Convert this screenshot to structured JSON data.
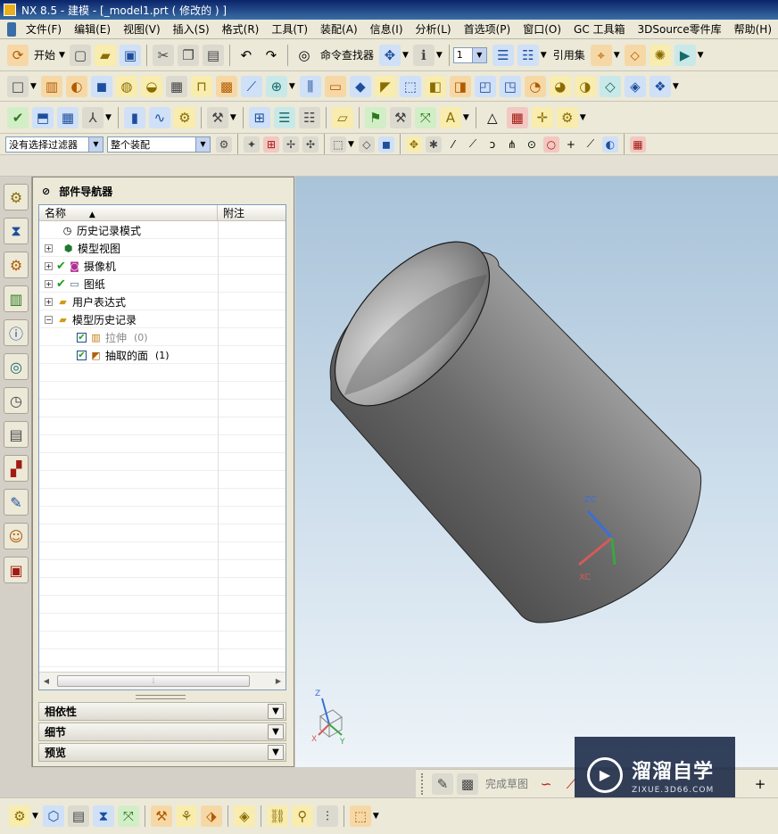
{
  "window": {
    "title": "NX 8.5 - 建模 - [_model1.prt  ( 修改的 ) ]"
  },
  "menubar": {
    "items": [
      "文件(F)",
      "编辑(E)",
      "视图(V)",
      "插入(S)",
      "格式(R)",
      "工具(T)",
      "装配(A)",
      "信息(I)",
      "分析(L)",
      "首选项(P)",
      "窗口(O)",
      "GC 工具箱",
      "3DSource零件库",
      "帮助(H)"
    ]
  },
  "toolbar": {
    "start_label": "开始",
    "command_finder_label": "命令查找器",
    "layer_value": "1",
    "reference_set_label": "引用集"
  },
  "selection_bar": {
    "filter_value": "没有选择过滤器",
    "scope_value": "整个装配"
  },
  "navigator": {
    "title": "部件导航器",
    "col_name": "名称",
    "col_note": "附注",
    "rows": [
      {
        "label": "历史记录模式"
      },
      {
        "label": "模型视图"
      },
      {
        "label": "摄像机"
      },
      {
        "label": "图纸"
      },
      {
        "label": "用户表达式"
      },
      {
        "label": "模型历史记录"
      },
      {
        "label": "拉伸",
        "count": "(0)"
      },
      {
        "label": "抽取的面",
        "count": "(1)"
      }
    ],
    "sections": [
      "相依性",
      "细节",
      "预览"
    ]
  },
  "viewport": {
    "csys_zc": "ZC",
    "csys_xc": "XC",
    "triad_z": "Z",
    "triad_x": "X",
    "triad_y": "Y"
  },
  "sketchbar": {
    "finish_sketch_label": "完成草图"
  },
  "watermark": {
    "name": "溜溜自学",
    "url": "ZIXUE.3D66.COM"
  }
}
